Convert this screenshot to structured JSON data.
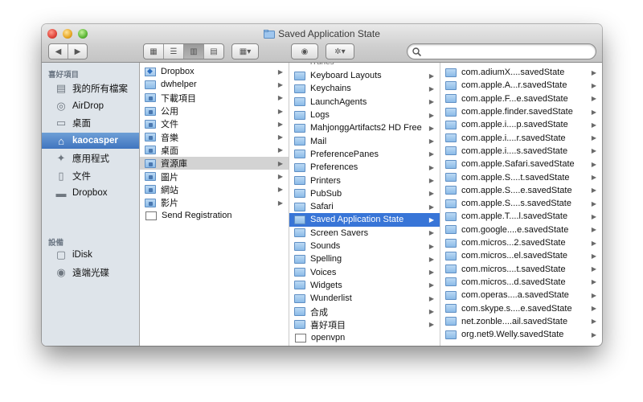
{
  "window": {
    "title": "Saved Application State"
  },
  "toolbar": {
    "back": "◀",
    "forward": "▶",
    "view_icons": "▦",
    "view_list": "☰",
    "view_columns": "▥",
    "view_coverflow": "▤",
    "arrange": "▦▾",
    "quicklook": "◉",
    "action": "✲▾"
  },
  "search": {
    "placeholder": ""
  },
  "sidebar": {
    "favorites_header": "喜好項目",
    "devices_header": "設備",
    "favorites": [
      {
        "label": "我的所有檔案",
        "icon": "all-files-icon"
      },
      {
        "label": "AirDrop",
        "icon": "airdrop-icon"
      },
      {
        "label": "桌面",
        "icon": "desktop-icon"
      },
      {
        "label": "kaocasper",
        "icon": "home-icon"
      },
      {
        "label": "應用程式",
        "icon": "applications-icon"
      },
      {
        "label": "文件",
        "icon": "documents-icon"
      },
      {
        "label": "Dropbox",
        "icon": "folder-icon"
      }
    ],
    "devices": [
      {
        "label": "iDisk",
        "icon": "idisk-icon"
      },
      {
        "label": "遠端光碟",
        "icon": "remote-disc-icon"
      }
    ]
  },
  "columns": {
    "col1": [
      {
        "label": "Dropbox",
        "arrow": "▶"
      },
      {
        "label": "dwhelper",
        "arrow": "▶"
      },
      {
        "label": "下載項目",
        "arrow": "▶"
      },
      {
        "label": "公用",
        "arrow": "▶"
      },
      {
        "label": "文件",
        "arrow": "▶"
      },
      {
        "label": "音樂",
        "arrow": "▶"
      },
      {
        "label": "桌面",
        "arrow": "▶"
      },
      {
        "label": "資源庫",
        "arrow": "▶"
      },
      {
        "label": "圖片",
        "arrow": "▶"
      },
      {
        "label": "網站",
        "arrow": "▶"
      },
      {
        "label": "影片",
        "arrow": "▶"
      },
      {
        "label": "Send Registration",
        "arrow": ""
      }
    ],
    "col2_partial_top": "iTunes",
    "col2": [
      {
        "label": "Keyboard Layouts",
        "arrow": "▶"
      },
      {
        "label": "Keychains",
        "arrow": "▶"
      },
      {
        "label": "LaunchAgents",
        "arrow": "▶"
      },
      {
        "label": "Logs",
        "arrow": "▶"
      },
      {
        "label": "MahjonggArtifacts2 HD Free",
        "arrow": "▶"
      },
      {
        "label": "Mail",
        "arrow": "▶"
      },
      {
        "label": "PreferencePanes",
        "arrow": "▶"
      },
      {
        "label": "Preferences",
        "arrow": "▶"
      },
      {
        "label": "Printers",
        "arrow": "▶"
      },
      {
        "label": "PubSub",
        "arrow": "▶"
      },
      {
        "label": "Safari",
        "arrow": "▶"
      },
      {
        "label": "Saved Application State",
        "arrow": "▶"
      },
      {
        "label": "Screen Savers",
        "arrow": "▶"
      },
      {
        "label": "Sounds",
        "arrow": "▶"
      },
      {
        "label": "Spelling",
        "arrow": "▶"
      },
      {
        "label": "Voices",
        "arrow": "▶"
      },
      {
        "label": "Widgets",
        "arrow": "▶"
      },
      {
        "label": "Wunderlist",
        "arrow": "▶"
      },
      {
        "label": "合成",
        "arrow": "▶"
      },
      {
        "label": "喜好項目",
        "arrow": "▶"
      },
      {
        "label": "openvpn",
        "arrow": ""
      }
    ],
    "col3": [
      "com.adiumX....savedState",
      "com.apple.A...r.savedState",
      "com.apple.F...e.savedState",
      "com.apple.finder.savedState",
      "com.apple.i....p.savedState",
      "com.apple.i....r.savedState",
      "com.apple.i....s.savedState",
      "com.apple.Safari.savedState",
      "com.apple.S....t.savedState",
      "com.apple.S....e.savedState",
      "com.apple.S....s.savedState",
      "com.apple.T....l.savedState",
      "com.google....e.savedState",
      "com.micros...2.savedState",
      "com.micros...el.savedState",
      "com.micros....t.savedState",
      "com.micros...d.savedState",
      "com.operas....a.savedState",
      "com.skype.s....e.savedState",
      "net.zonble....ail.savedState",
      "org.net9.Welly.savedState"
    ],
    "col3_arrow": "▶"
  }
}
